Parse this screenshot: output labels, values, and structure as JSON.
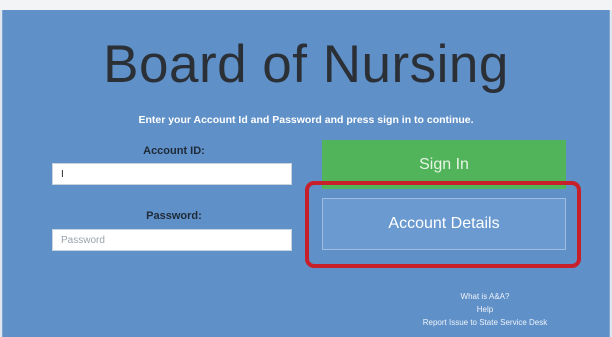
{
  "page": {
    "title": "Board of Nursing",
    "instructions": "Enter your Account Id and Password and press sign in to continue."
  },
  "form": {
    "account_label": "Account ID:",
    "account_value": "I",
    "password_label": "Password:",
    "password_placeholder": "Password"
  },
  "buttons": {
    "sign_in": "Sign In",
    "account_details": "Account Details"
  },
  "links": {
    "what_is": "What is A&A?",
    "help": "Help",
    "report_issue": "Report Issue to State Service Desk"
  },
  "colors": {
    "panel_bg": "#5f90c8",
    "sign_in_bg": "#52b45a",
    "highlight_border": "#c8202b"
  }
}
